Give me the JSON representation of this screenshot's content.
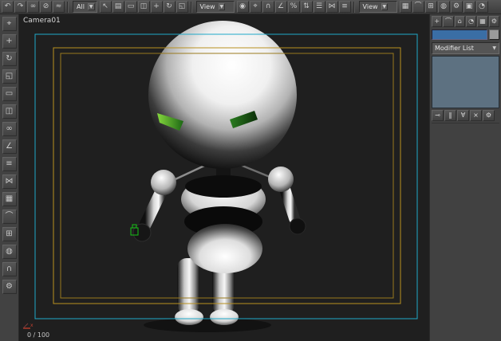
{
  "colors": {
    "toolbar_bg": "#484848",
    "panel_bg": "#414141",
    "viewport_bg": "#1f1f1f",
    "safe_frame_live": "#1fa9c9",
    "safe_frame_action": "#b8901f",
    "safe_frame_title": "#9a7a1d",
    "eye_green_left": "#86d83e",
    "eye_green_right": "#2b7d20",
    "helper_green": "#16c216",
    "modifier_stack_bg": "#5d7181",
    "name_field_bg": "#3a6ea5"
  },
  "icons": {
    "chevron_down": "▼"
  },
  "top_toolbar": {
    "filter_dropdown": {
      "label": "All"
    },
    "coord_dropdown": {
      "label": "View"
    },
    "view_dropdown2": {
      "label": "View"
    },
    "g1": [
      {
        "name": "undo-icon",
        "glyph": "↶"
      },
      {
        "name": "redo-icon",
        "glyph": "↷"
      },
      {
        "name": "select-and-link-icon",
        "glyph": "∞"
      },
      {
        "name": "unlink-selection-icon",
        "glyph": "⊘"
      },
      {
        "name": "bind-to-spacewarp-icon",
        "glyph": "≈"
      }
    ],
    "g2": [
      {
        "name": "select-object-icon",
        "glyph": "↖"
      },
      {
        "name": "select-by-name-icon",
        "glyph": "▤"
      },
      {
        "name": "rectangular-selection-icon",
        "glyph": "▭"
      },
      {
        "name": "window-crossing-icon",
        "glyph": "◫"
      },
      {
        "name": "select-and-move-icon",
        "glyph": "+"
      },
      {
        "name": "select-and-rotate-icon",
        "glyph": "↻"
      },
      {
        "name": "select-and-scale-icon",
        "glyph": "◱"
      }
    ],
    "g3": [
      {
        "name": "use-center-icon",
        "glyph": "◉"
      },
      {
        "name": "select-and-manipulate-icon",
        "glyph": "⌖"
      },
      {
        "name": "snap-toggle-icon",
        "glyph": "∩"
      },
      {
        "name": "angle-snap-icon",
        "glyph": "∠"
      },
      {
        "name": "percent-snap-icon",
        "glyph": "%"
      },
      {
        "name": "spinner-snap-icon",
        "glyph": "⇅"
      },
      {
        "name": "named-selection-sets-icon",
        "glyph": "☰"
      },
      {
        "name": "mirror-icon",
        "glyph": "⋈"
      },
      {
        "name": "align-icon",
        "glyph": "≡"
      }
    ],
    "g4": [
      {
        "name": "layer-manager-icon",
        "glyph": "▦"
      },
      {
        "name": "curve-editor-icon",
        "glyph": "⌒"
      },
      {
        "name": "schematic-view-icon",
        "glyph": "⊞"
      },
      {
        "name": "material-editor-icon",
        "glyph": "◍"
      },
      {
        "name": "render-setup-icon",
        "glyph": "⚙"
      },
      {
        "name": "render-type-icon",
        "glyph": "▣"
      },
      {
        "name": "quick-render-icon",
        "glyph": "◔"
      }
    ]
  },
  "left_toolbar": {
    "icons": [
      {
        "name": "select-tool-icon",
        "glyph": "⌖"
      },
      {
        "name": "move-tool-icon",
        "glyph": "+"
      },
      {
        "name": "rotate-tool-icon",
        "glyph": "↻"
      },
      {
        "name": "scale-tool-icon",
        "glyph": "◱"
      },
      {
        "name": "region-tool-icon",
        "glyph": "▭"
      },
      {
        "name": "window-tool-icon",
        "glyph": "◫"
      },
      {
        "name": "link-tool-icon",
        "glyph": "∞"
      },
      {
        "name": "angle-tool-icon",
        "glyph": "∠"
      },
      {
        "name": "align-tool-icon",
        "glyph": "≡"
      },
      {
        "name": "mirror-tool-icon",
        "glyph": "⋈"
      },
      {
        "name": "layers-tool-icon",
        "glyph": "▦"
      },
      {
        "name": "curves-tool-icon",
        "glyph": "⌒"
      },
      {
        "name": "schematic-tool-icon",
        "glyph": "⊞"
      },
      {
        "name": "material-tool-icon",
        "glyph": "◍"
      },
      {
        "name": "snap-tool-icon",
        "glyph": "∩"
      },
      {
        "name": "settings-tool-icon",
        "glyph": "⚙"
      }
    ]
  },
  "viewport": {
    "label": "Camera01",
    "frame_counter": "0 / 100"
  },
  "right_panel": {
    "tabs": [
      {
        "name": "create-tab-icon",
        "glyph": "+"
      },
      {
        "name": "modify-tab-icon",
        "glyph": "⌒"
      },
      {
        "name": "hierarchy-tab-icon",
        "glyph": "⌂"
      },
      {
        "name": "motion-tab-icon",
        "glyph": "◔"
      },
      {
        "name": "display-tab-icon",
        "glyph": "▦"
      },
      {
        "name": "utilities-tab-icon",
        "glyph": "⚙"
      }
    ],
    "name_field_value": "",
    "modifier_list_label": "Modifier List",
    "stack_buttons": [
      {
        "name": "pin-stack-icon",
        "glyph": "⊸"
      },
      {
        "name": "show-end-result-icon",
        "glyph": "‖"
      },
      {
        "name": "make-unique-icon",
        "glyph": "∀"
      },
      {
        "name": "remove-modifier-icon",
        "glyph": "×"
      },
      {
        "name": "configure-modifier-sets-icon",
        "glyph": "⚙"
      }
    ]
  }
}
